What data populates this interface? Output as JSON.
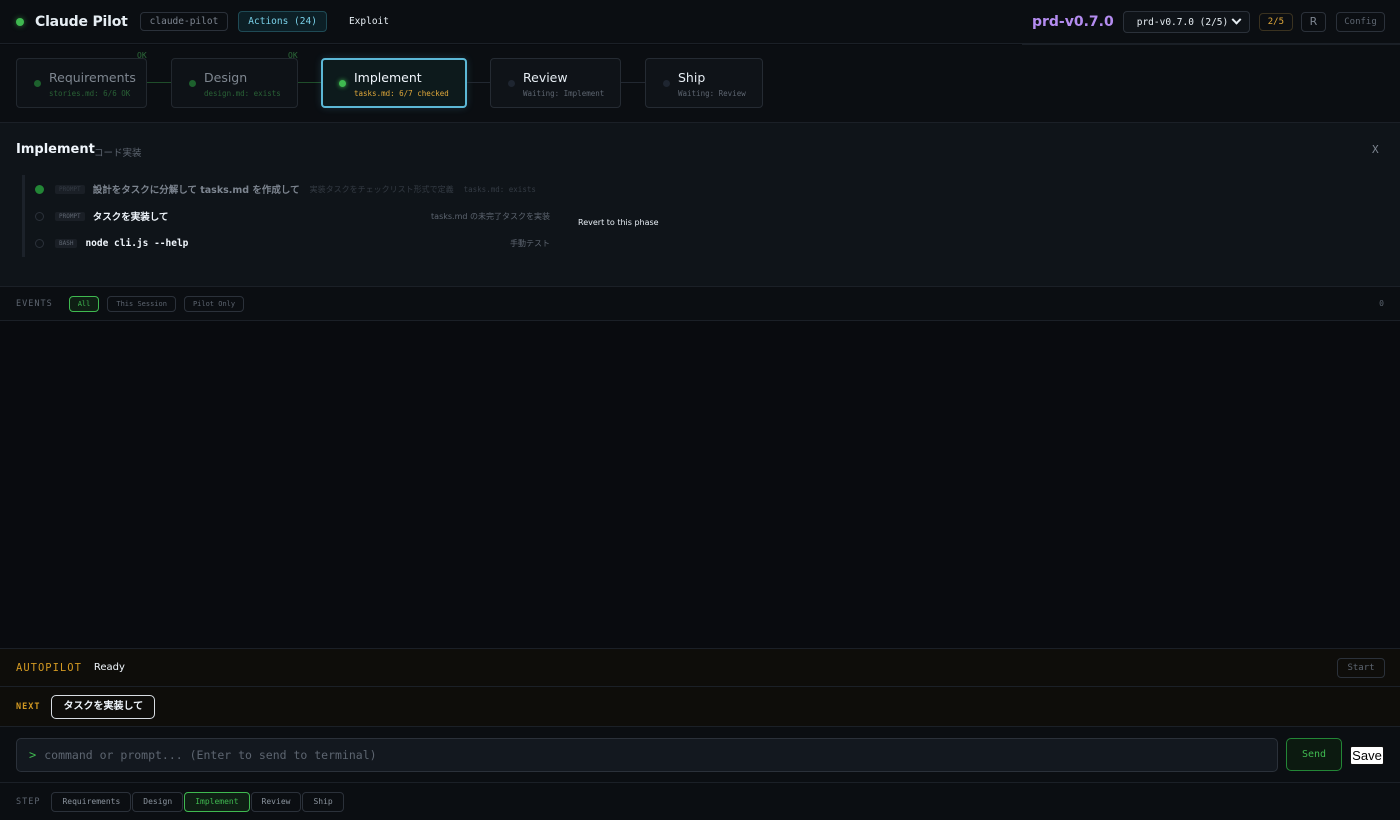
{
  "header": {
    "title": "Claude Pilot",
    "repo_chip": "claude-pilot",
    "actions_chip": "Actions (24)",
    "exploit_label": "Exploit",
    "prd_name": "prd-v0.7.0",
    "prd_select": "prd-v0.7.0 (2/5)",
    "progress": "2/5",
    "r_button": "R",
    "config_button": "Config"
  },
  "pipeline": {
    "phases": [
      {
        "name": "Requirements",
        "sub": "stories.md: 6/6 OK",
        "ok": "OK",
        "state": "done"
      },
      {
        "name": "Design",
        "sub": "design.md: exists",
        "ok": "OK",
        "state": "done"
      },
      {
        "name": "Implement",
        "sub": "tasks.md: 6/7 checked",
        "state": "active"
      },
      {
        "name": "Review",
        "sub": "Waiting: Implement",
        "state": "pending"
      },
      {
        "name": "Ship",
        "sub": "Waiting: Review",
        "state": "pending"
      }
    ]
  },
  "implement_panel": {
    "title": "Implement",
    "subtitle": "コード実装",
    "close": "X",
    "tasks": [
      {
        "tag": "PROMPT",
        "text": "設計をタスクに分解して tasks.md を作成して",
        "desc": "実装タスクをチェックリスト形式で定義",
        "meta": "tasks.md: exists",
        "done": true
      },
      {
        "tag": "PROMPT",
        "text": "タスクを実装して",
        "desc": "tasks.md の未完了タスクを実装",
        "done": false
      },
      {
        "tag": "BASH",
        "text": "node cli.js --help",
        "desc": "手動テスト",
        "done": false
      }
    ],
    "revert": "Revert to this phase"
  },
  "events": {
    "label": "EVENTS",
    "filters": [
      "All",
      "This Session",
      "Pilot Only"
    ],
    "active_filter": "All",
    "count": "0"
  },
  "autopilot": {
    "label": "AUTOPILOT",
    "status": "Ready",
    "start": "Start"
  },
  "next": {
    "label": "NEXT",
    "button": "タスクを実装して"
  },
  "command": {
    "prompt_symbol": ">",
    "placeholder": "command or prompt... (Enter to send to terminal)",
    "send": "Send",
    "save": "Save"
  },
  "step": {
    "label": "STEP",
    "buttons": [
      "Requirements",
      "Design",
      "Implement",
      "Review",
      "Ship"
    ],
    "active": "Implement"
  },
  "colors": {
    "accent_green": "#3fb950",
    "accent_cyan": "#5cb8d6",
    "accent_amber": "#d29922",
    "accent_purple": "#b48cf0"
  }
}
